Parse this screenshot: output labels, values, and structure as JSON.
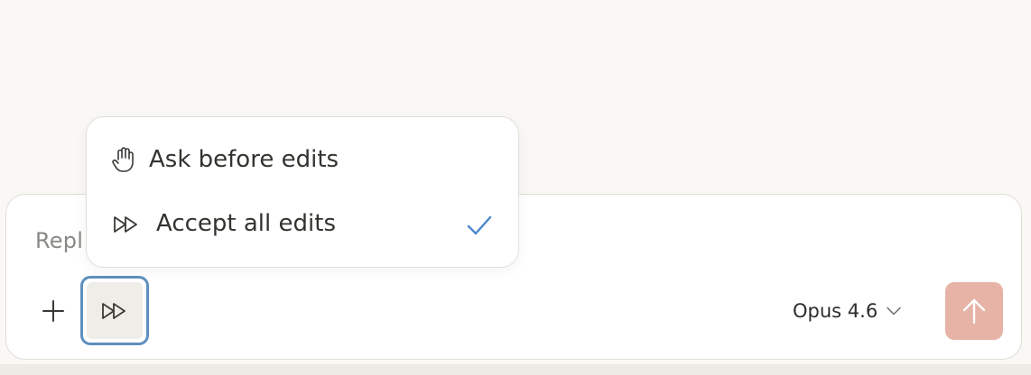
{
  "composer": {
    "placeholder": "Repl",
    "mode_button_icon": "fast-forward-icon",
    "add_icon": "plus-icon",
    "model_label": "Opus 4.6",
    "model_chevron_icon": "chevron-down-icon",
    "send_icon": "arrow-up-icon",
    "send_color": "#e6b3a6"
  },
  "mode_menu": {
    "items": [
      {
        "label": "Ask before edits",
        "icon": "hand-icon",
        "selected": false
      },
      {
        "label": "Accept all edits",
        "icon": "fast-forward-icon",
        "selected": true
      }
    ],
    "check_icon": "checkmark-icon",
    "check_color": "#4a88cc"
  }
}
